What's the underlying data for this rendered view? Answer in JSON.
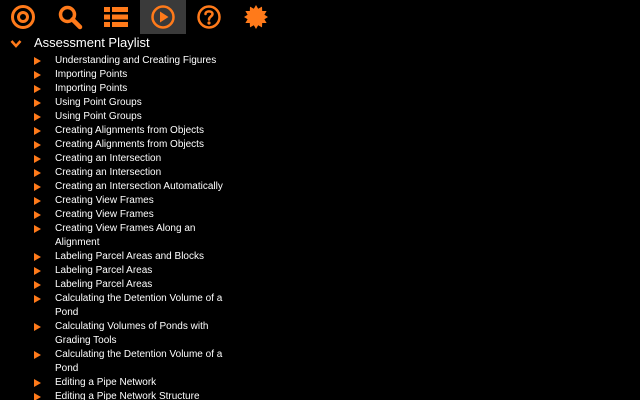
{
  "colors": {
    "accent": "#ff7a1a",
    "background": "#000000",
    "active_tool": "#3a3a3a",
    "text": "#ffffff"
  },
  "toolbar": {
    "tools": [
      {
        "icon": "target-icon",
        "active": false
      },
      {
        "icon": "search-icon",
        "active": false
      },
      {
        "icon": "list-icon",
        "active": false
      },
      {
        "icon": "play-icon",
        "active": true
      },
      {
        "icon": "help-icon",
        "active": false
      },
      {
        "icon": "settings-icon",
        "active": false
      }
    ]
  },
  "playlist": {
    "title": "Assessment Playlist",
    "items": [
      "Understanding and Creating Figures",
      "Importing Points",
      "Importing Points",
      "Using Point Groups",
      "Using Point Groups",
      "Creating Alignments from Objects",
      "Creating Alignments from Objects",
      "Creating an Intersection",
      "Creating an Intersection",
      "Creating an Intersection Automatically",
      "Creating View Frames",
      "Creating View Frames",
      "Creating View Frames Along an Alignment",
      "Labeling Parcel Areas and Blocks",
      "Labeling Parcel Areas",
      "Labeling Parcel Areas",
      "Calculating the Detention Volume of a Pond",
      "Calculating Volumes of Ponds with Grading Tools",
      "Calculating the Detention Volume of a Pond",
      "Editing a Pipe Network",
      "Editing a Pipe Network Structure"
    ]
  }
}
